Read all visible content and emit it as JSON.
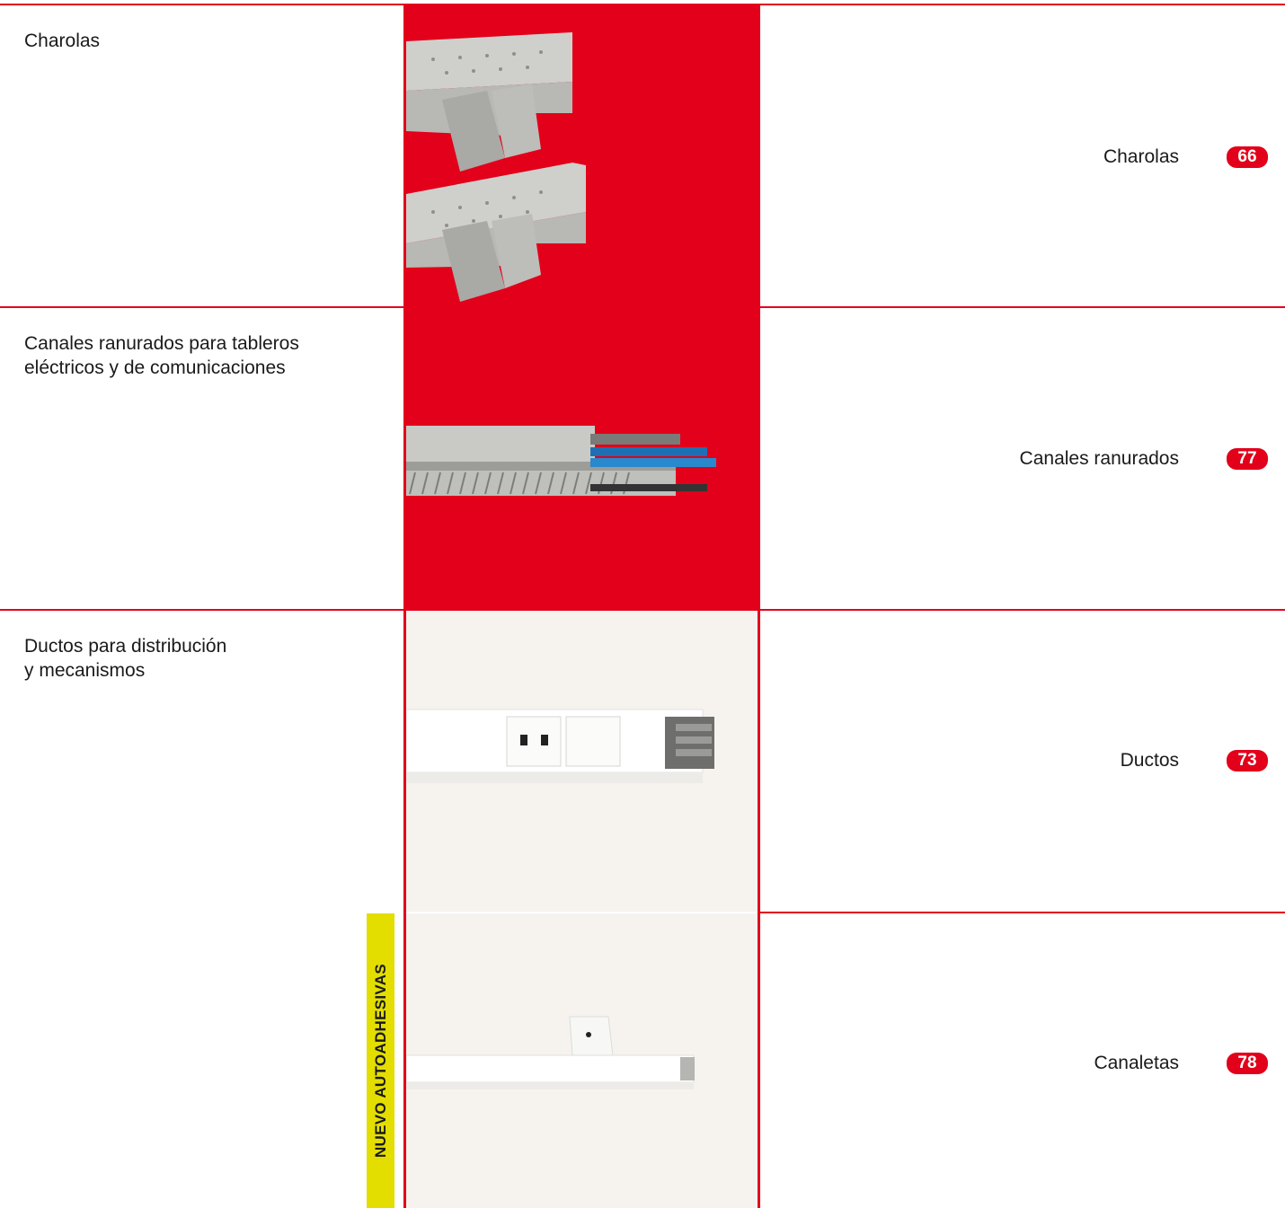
{
  "colors": {
    "accent": "#e2001a",
    "cream": "#f6f3ef",
    "tag": "#e3de00"
  },
  "sections": [
    {
      "title": "Charolas",
      "link": "Charolas",
      "page": "66"
    },
    {
      "title_line1": "Canales ranurados para tableros",
      "title_line2": "eléctricos y de comunicaciones",
      "link": "Canales ranurados",
      "page": "77"
    },
    {
      "title_line1": "Ductos para distribución",
      "title_line2": "y mecanismos",
      "link": "Ductos",
      "page": "73"
    },
    {
      "link": "Canaletas",
      "page": "78",
      "tag": "NUEVO AUTOADHESIVAS"
    }
  ]
}
